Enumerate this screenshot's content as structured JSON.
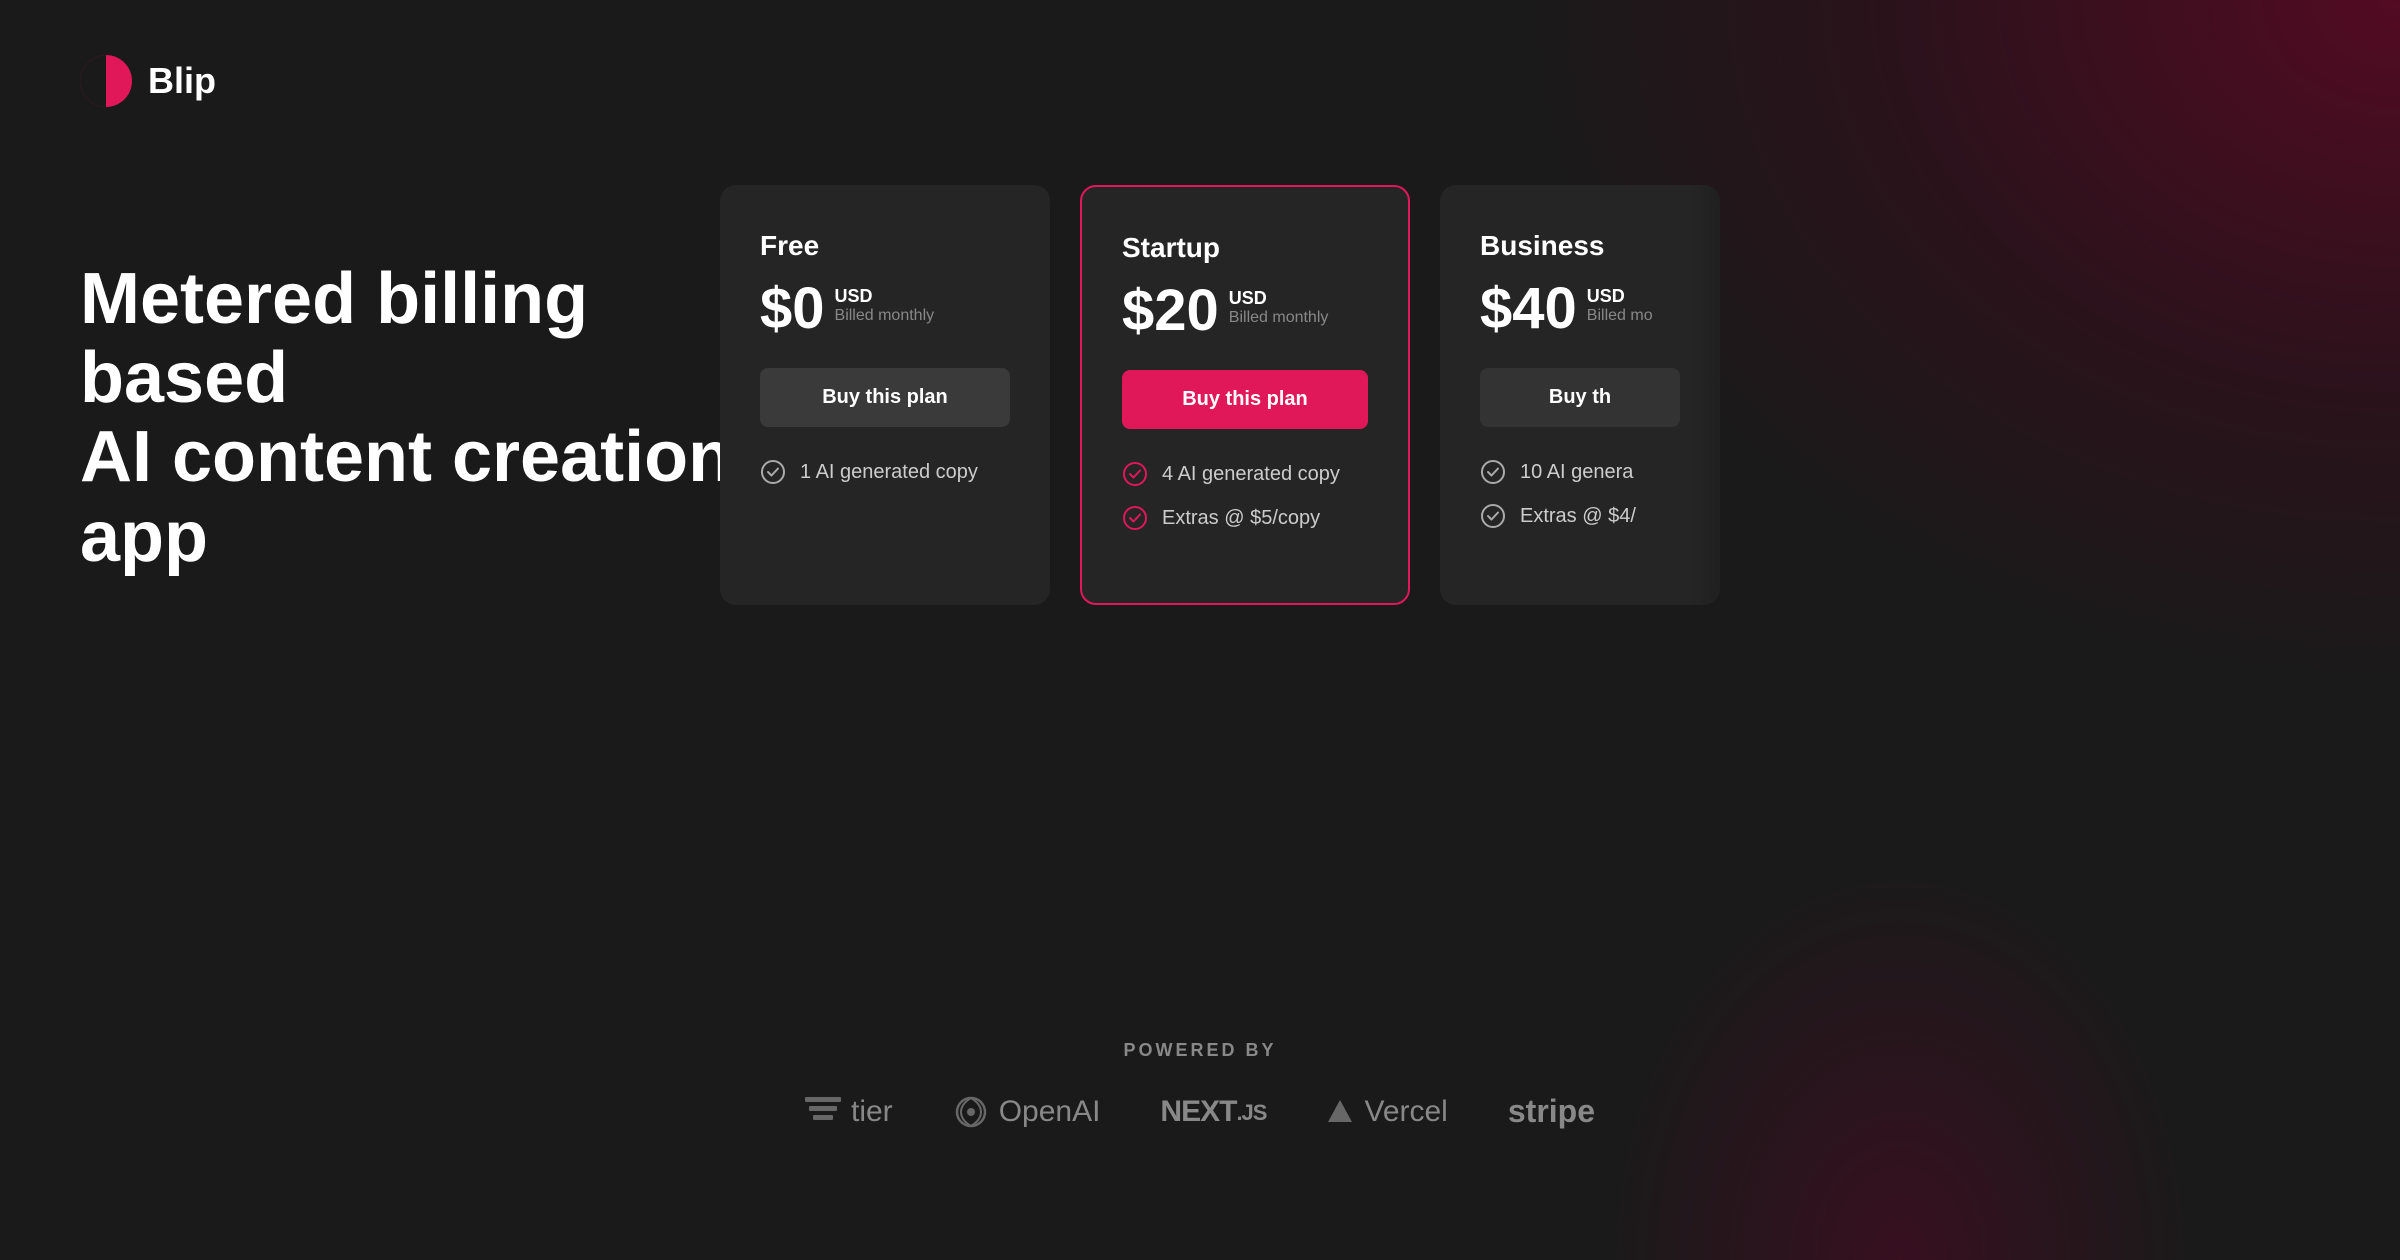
{
  "app": {
    "name": "Blip"
  },
  "hero": {
    "title_line1": "Metered billing based",
    "title_line2": "AI content creation app"
  },
  "pricing": {
    "plans": [
      {
        "id": "free",
        "name": "Free",
        "price": "$0",
        "currency": "USD",
        "billing": "Billed monthly",
        "button_label": "Buy this plan",
        "button_style": "default",
        "featured": false,
        "features": [
          "1 AI generated copy"
        ]
      },
      {
        "id": "startup",
        "name": "Startup",
        "price": "$20",
        "currency": "USD",
        "billing": "Billed monthly",
        "button_label": "Buy this plan",
        "button_style": "featured",
        "featured": true,
        "features": [
          "4 AI generated copy",
          "Extras @ $5/copy"
        ]
      },
      {
        "id": "business",
        "name": "Business",
        "price": "$40",
        "currency": "USD",
        "billing": "Billed mo",
        "button_label": "Buy th",
        "button_style": "dark",
        "featured": false,
        "partial": true,
        "features": [
          "10 AI genera",
          "Extras @ $4/"
        ]
      }
    ]
  },
  "powered_by": {
    "label": "POWERED BY",
    "brands": [
      "tier",
      "OpenAI",
      "NEXT.js",
      "Vercel",
      "stripe"
    ]
  }
}
